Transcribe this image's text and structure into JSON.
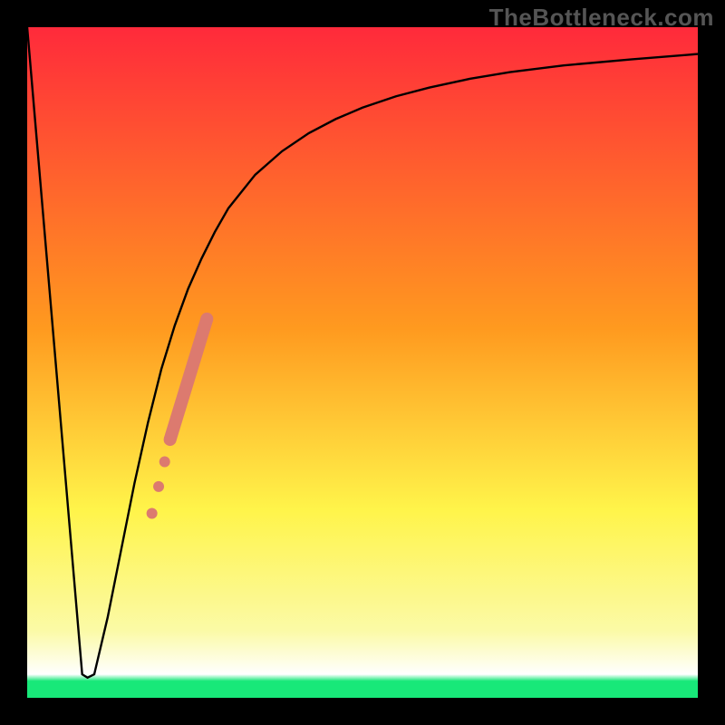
{
  "watermark": "TheBottleneck.com",
  "colors": {
    "frame": "#000000",
    "curve": "#000000",
    "marker": "#dc7a6f",
    "gradient_top_red": "#ff2a3b",
    "gradient_orange": "#ff9a1f",
    "gradient_yellow": "#fff44a",
    "gradient_pale_yellow": "#fbfaa6",
    "gradient_green": "#18e879"
  },
  "chart_data": {
    "type": "line",
    "title": "",
    "xlabel": "",
    "ylabel": "",
    "xlim": [
      0,
      100
    ],
    "ylim": [
      0,
      100
    ],
    "gradient_stops": [
      {
        "offset": 0.0,
        "color": "#ff2a3b"
      },
      {
        "offset": 0.45,
        "color": "#ff9a1f"
      },
      {
        "offset": 0.72,
        "color": "#fff44a"
      },
      {
        "offset": 0.9,
        "color": "#fbfaa6"
      },
      {
        "offset": 0.965,
        "color": "#ffffff"
      },
      {
        "offset": 0.975,
        "color": "#18e879"
      },
      {
        "offset": 1.0,
        "color": "#18e879"
      }
    ],
    "series": [
      {
        "name": "curve",
        "x": [
          0,
          8.2,
          9.0,
          10.0,
          12,
          14,
          16,
          18,
          20,
          22,
          24,
          26,
          28,
          30,
          34,
          38,
          42,
          46,
          50,
          55,
          60,
          66,
          72,
          80,
          90,
          100
        ],
        "y": [
          100,
          3.5,
          3.0,
          3.5,
          12,
          22,
          32,
          41,
          49,
          55.5,
          61,
          65.5,
          69.5,
          73,
          78,
          81.5,
          84.2,
          86.3,
          88,
          89.7,
          91,
          92.3,
          93.3,
          94.3,
          95.2,
          96
        ]
      }
    ],
    "markers": {
      "name": "highlight",
      "color": "#dc7a6f",
      "points": [
        {
          "x": 18.6,
          "y": 27.5,
          "r": 6
        },
        {
          "x": 19.6,
          "y": 31.5,
          "r": 6
        },
        {
          "x": 20.5,
          "y": 35.2,
          "r": 6
        }
      ],
      "band": {
        "x0": 21.3,
        "y0": 38.5,
        "x1": 26.8,
        "y1": 56.5,
        "half_width": 7
      }
    }
  }
}
